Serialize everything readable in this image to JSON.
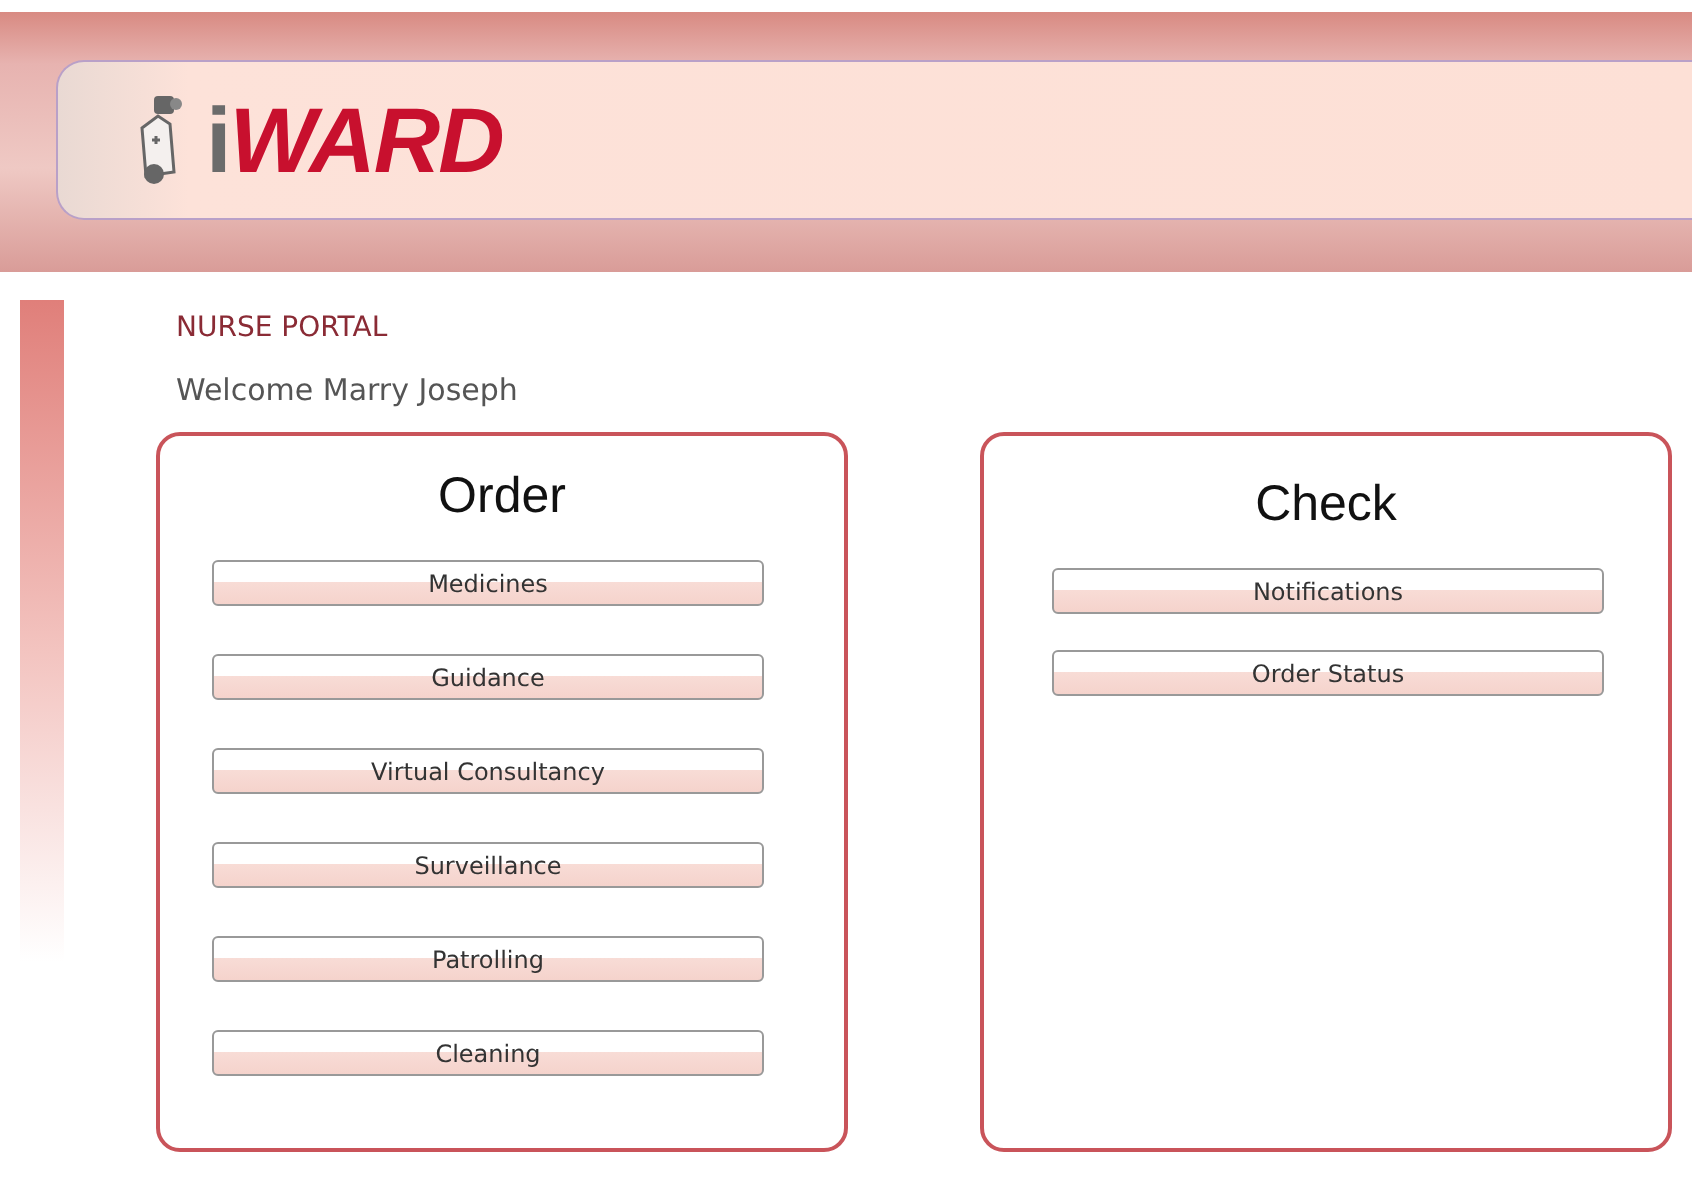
{
  "header": {
    "logo": "iWARD"
  },
  "portal": {
    "title": "NURSE PORTAL",
    "welcome": "Welcome Marry Joseph"
  },
  "panels": [
    {
      "title": "Order",
      "buttons": [
        "Medicines",
        "Guidance",
        "Virtual Consultancy",
        "Surveillance",
        "Patrolling",
        "Cleaning"
      ]
    },
    {
      "title": "Check",
      "buttons": [
        "Notifications",
        "Order Status"
      ]
    }
  ]
}
